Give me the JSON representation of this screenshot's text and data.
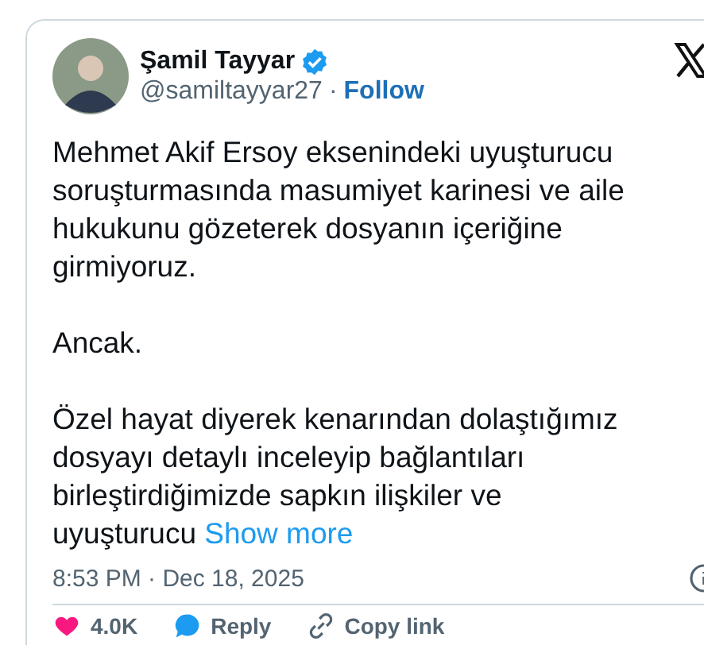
{
  "author": {
    "name": "Şamil Tayyar",
    "verified": true,
    "handle": "@samiltayyar27",
    "separator": "·",
    "follow": "Follow"
  },
  "paragraphs": [
    "Mehmet Akif Ersoy eksenindeki uyuşturucu soruşturmasında masumiyet karinesi ve aile hukukunu gözeterek dosyanın içeriğine girmiyoruz.",
    "Ancak.",
    "Özel hayat diyerek kenarından dolaştığımız dosyayı detaylı inceleyip bağlantıları birleştirdiğimizde sapkın ilişkiler ve uyuşturucu"
  ],
  "show_more": "Show more",
  "timestamp": "8:53 PM · Dec 18, 2025",
  "actions": [
    {
      "kind": "like",
      "label": "4.0K"
    },
    {
      "kind": "reply",
      "label": "Reply"
    },
    {
      "kind": "link",
      "label": "Copy link"
    }
  ]
}
